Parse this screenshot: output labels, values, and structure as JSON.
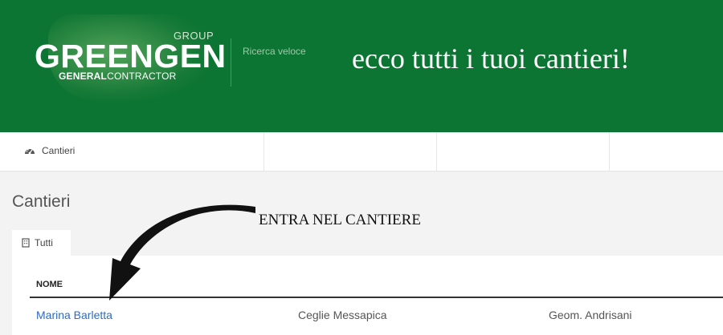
{
  "header": {
    "logo": {
      "group": "GROUP",
      "main": "GREENGEN",
      "sub_bold": "GENERAL",
      "sub_rest": "CONTRACTOR"
    },
    "quick_search": "Ricerca veloce",
    "overlay_title": "ecco tutti i tuoi cantieri!",
    "colors": {
      "header_bg": "#0d7533"
    }
  },
  "navbar": {
    "items": [
      {
        "label": "Cantieri",
        "icon": "dashboard-gauge-icon"
      }
    ]
  },
  "page": {
    "title": "Cantieri",
    "annotation": "ENTRA NEL CANTIERE",
    "tabs": [
      {
        "label": "Tutti",
        "icon": "building-icon"
      }
    ]
  },
  "table": {
    "column_header": "NOME",
    "rows": [
      {
        "name": "Marina Barletta",
        "city": "Ceglie Messapica",
        "manager": "Geom. Andrisani"
      }
    ],
    "colors": {
      "link": "#2b6cc4"
    }
  }
}
